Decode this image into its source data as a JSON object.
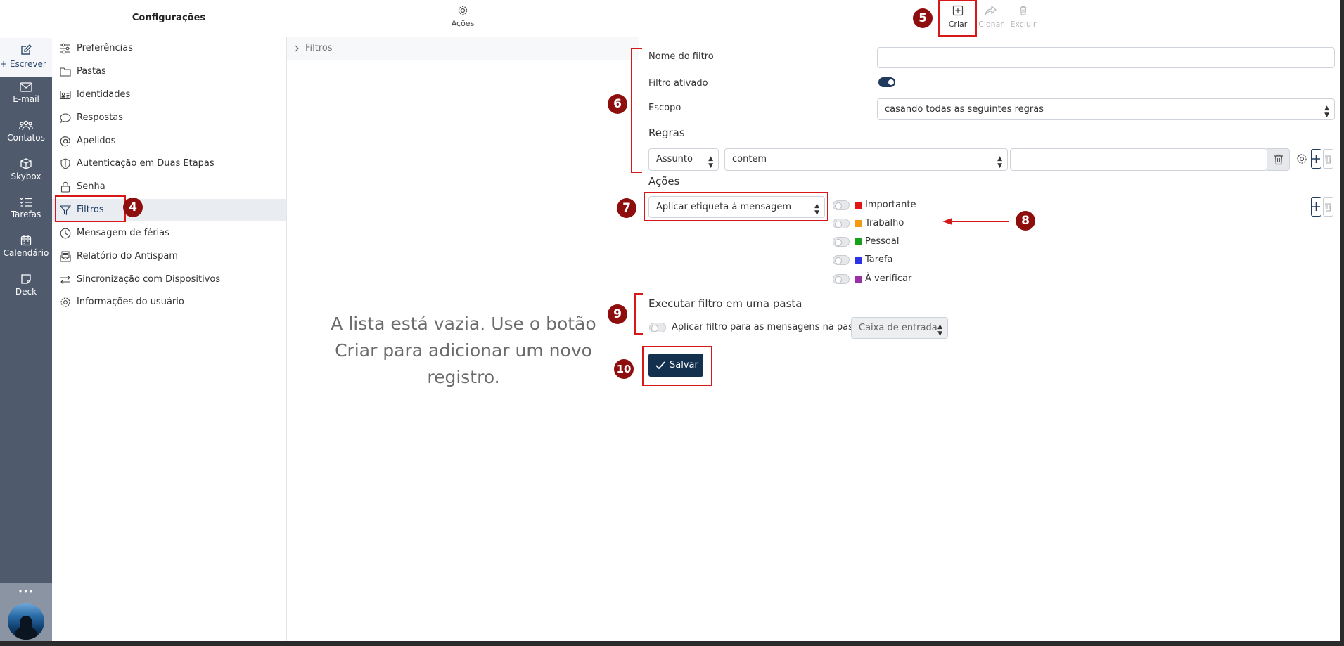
{
  "topbar": {
    "settings_title": "Configurações",
    "actions_label": "Ações",
    "create_label": "Criar",
    "clone_label": "Clonar",
    "delete_label": "Excluir"
  },
  "rail": {
    "compose": "+ Escrever",
    "items": [
      "E-mail",
      "Contatos",
      "Skybox",
      "Tarefas",
      "Calendário",
      "Deck"
    ],
    "more": "•••"
  },
  "nav": {
    "items": [
      {
        "label": "Preferências",
        "icon": "sliders-icon"
      },
      {
        "label": "Pastas",
        "icon": "folder-icon"
      },
      {
        "label": "Identidades",
        "icon": "id-card-icon"
      },
      {
        "label": "Respostas",
        "icon": "chat-bubble-icon"
      },
      {
        "label": "Apelidos",
        "icon": "at-icon"
      },
      {
        "label": "Autenticação em Duas Etapas",
        "icon": "shield-icon"
      },
      {
        "label": "Senha",
        "icon": "lock-icon"
      },
      {
        "label": "Filtros",
        "icon": "filter-icon"
      },
      {
        "label": "Mensagem de férias",
        "icon": "clock-icon"
      },
      {
        "label": "Relatório do Antispam",
        "icon": "mail-report-icon"
      },
      {
        "label": "Sincronização com Dispositivos",
        "icon": "sync-arrows-icon"
      },
      {
        "label": "Informações do usuário",
        "icon": "gear-icon"
      }
    ],
    "active": "Filtros"
  },
  "list": {
    "breadcrumb": "Filtros",
    "empty_message": "A lista está vazia. Use o botão Criar para adicionar um novo registro."
  },
  "form": {
    "filter_name_label": "Nome do filtro",
    "filter_name_value": "",
    "enabled_label": "Filtro ativado",
    "enabled": true,
    "scope_label": "Escopo",
    "scope_value": "casando todas as seguintes regras",
    "rules_heading": "Regras",
    "rule": {
      "field": "Assunto",
      "operator": "contem",
      "value": ""
    },
    "actions_heading": "Ações",
    "action_value": "Aplicar etiqueta à mensagem",
    "tags": [
      {
        "name": "Importante",
        "color": "#e31414",
        "on": false
      },
      {
        "name": "Trabalho",
        "color": "#f29a12",
        "on": false
      },
      {
        "name": "Pessoal",
        "color": "#17a01a",
        "on": false
      },
      {
        "name": "Tarefa",
        "color": "#2f33e6",
        "on": false
      },
      {
        "name": "À verificar",
        "color": "#9a2fa8",
        "on": false
      }
    ],
    "run_heading": "Executar filtro em uma pasta",
    "run_label": "Aplicar filtro para as mensagens na pasta",
    "run_folder": "Caixa de entrada",
    "save_label": "Salvar"
  },
  "annotations": {
    "badge4": "4",
    "badge5": "5",
    "badge6": "6",
    "badge7": "7",
    "badge8": "8",
    "badge9": "9",
    "badge10": "10"
  },
  "colors": {
    "accent": "#1f3a5c",
    "annotation": "#d81818",
    "badge": "#8e0e0e",
    "rail": "#4f5a6d"
  }
}
